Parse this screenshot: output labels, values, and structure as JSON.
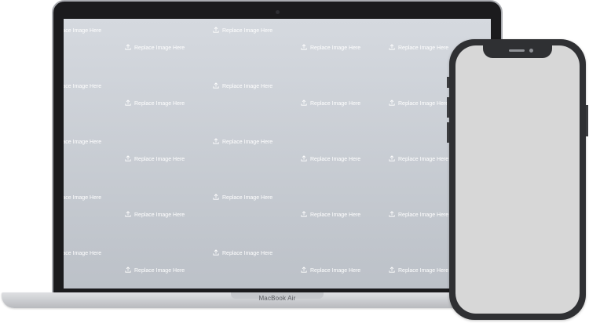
{
  "laptop": {
    "brand_label": "MacBook Air",
    "placeholder_text": "Replace Image Here"
  },
  "colors": {
    "screen_gradient_top": "#d5d9df",
    "screen_gradient_bottom": "#bcc1c8",
    "bezel": "#1b1b1d",
    "phone_body": "#2f3033",
    "phone_screen": "#d7d7d7"
  },
  "icons": {
    "placeholder": "upload-icon"
  }
}
